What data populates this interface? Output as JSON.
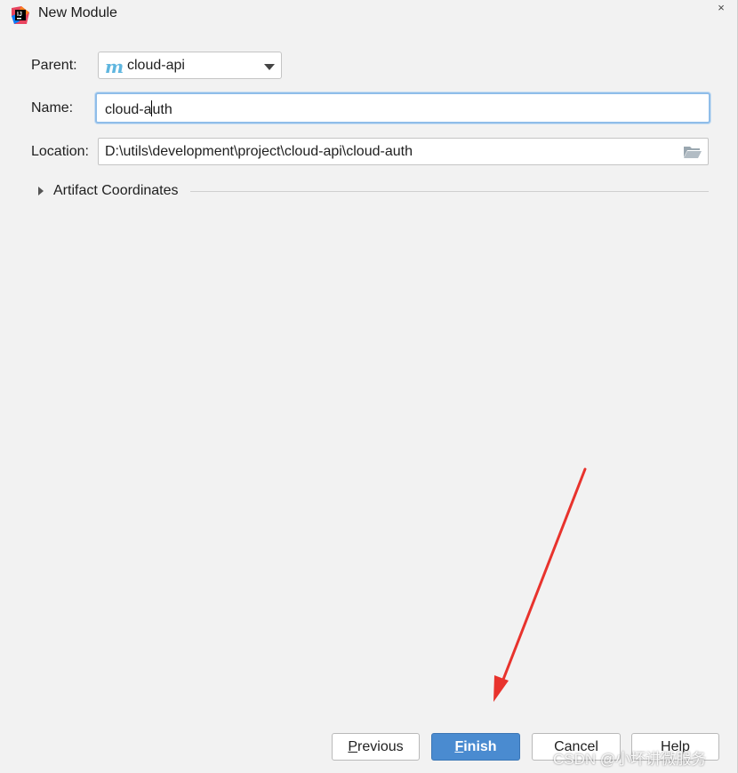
{
  "window": {
    "title": "New Module",
    "close_glyph": "×",
    "icon": "intellij-idea-icon"
  },
  "form": {
    "parent": {
      "label": "Parent:",
      "icon_glyph": "m",
      "value": "cloud-api"
    },
    "name": {
      "label": "Name:",
      "value_before_cursor": "cloud-a",
      "value_after_cursor": "uth"
    },
    "location": {
      "label": "Location:",
      "value": "D:\\utils\\development\\project\\cloud-api\\cloud-auth"
    },
    "artifact": {
      "label": "Artifact Coordinates",
      "expanded": false
    }
  },
  "buttons": {
    "previous": {
      "mnemonic": "P",
      "rest": "revious"
    },
    "finish": {
      "mnemonic": "F",
      "rest": "inish"
    },
    "cancel": {
      "label": "Cancel"
    },
    "help": {
      "label": "Help"
    }
  },
  "annotation": {
    "arrow_color": "#e8332d"
  },
  "watermark": "CSDN @小坏讲微服务",
  "colors": {
    "background": "#f2f2f2",
    "primary_button": "#4a8bd0",
    "focus_border": "#8fbde9"
  }
}
